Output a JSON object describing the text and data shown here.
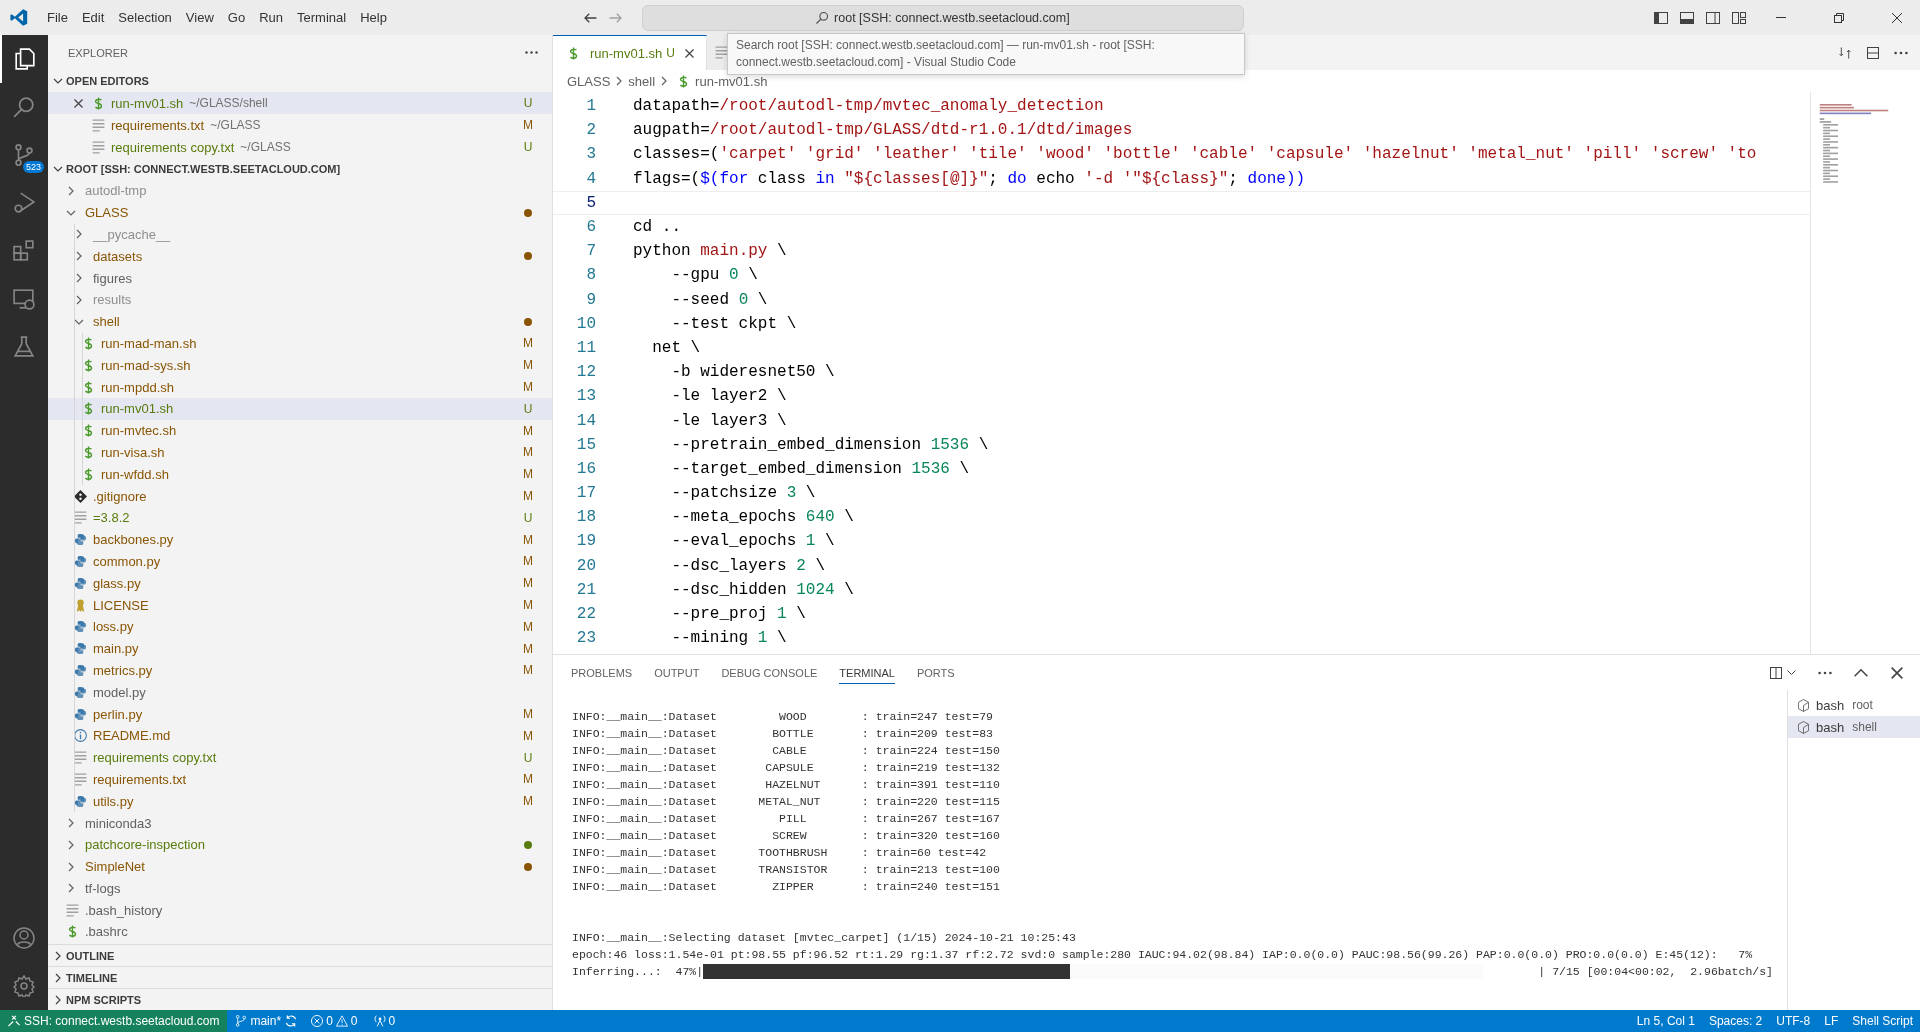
{
  "title_bar": {
    "menus": [
      "File",
      "Edit",
      "Selection",
      "View",
      "Go",
      "Run",
      "Terminal",
      "Help"
    ],
    "command_center": "root [SSH: connect.westb.seetacloud.com]"
  },
  "tooltip": "Search root [SSH: connect.westb.seetacloud.com] — run-mv01.sh - root [SSH: connect.westb.seetacloud.com] - Visual Studio Code",
  "activity_bar": {
    "items": [
      {
        "kind": "explorer",
        "selected": true
      },
      {
        "kind": "search",
        "selected": false
      },
      {
        "kind": "source-control",
        "selected": false,
        "badge": "523"
      },
      {
        "kind": "run",
        "selected": false
      },
      {
        "kind": "extensions",
        "selected": false
      },
      {
        "kind": "remote",
        "selected": false
      },
      {
        "kind": "testing",
        "selected": false
      }
    ],
    "bottom": [
      {
        "kind": "account"
      },
      {
        "kind": "settings"
      }
    ]
  },
  "sidebar": {
    "title": "EXPLORER",
    "open_editors": {
      "title": "OPEN EDITORS",
      "expanded": true,
      "items": [
        {
          "name": "run-mv01.sh",
          "description": "~/GLASS/shell",
          "kind": "shell",
          "color": "#587c0c",
          "badge": "U",
          "selected": true
        },
        {
          "name": "requirements.txt",
          "description": "~/GLASS",
          "kind": "text",
          "color": "#895503",
          "badge": "M",
          "selected": false
        },
        {
          "name": "requirements copy.txt",
          "description": "~/GLASS",
          "kind": "text",
          "color": "#587c0c",
          "badge": "U",
          "selected": false
        }
      ]
    },
    "root": {
      "title": "ROOT [SSH: CONNECT.WESTB.SEETACLOUD.COM]",
      "expanded": true,
      "tree": [
        {
          "name": "autodl-tmp",
          "kind": "folder",
          "color": "#8e8e90",
          "dot": false,
          "expanded": false,
          "selected": false
        },
        {
          "name": "GLASS",
          "kind": "folder",
          "color": "#895503",
          "dot": true,
          "expanded": true,
          "selected": false,
          "children": [
            {
              "name": "__pycache__",
              "kind": "folder",
              "color": "#8e8e90",
              "dot": false,
              "expanded": false,
              "selected": false
            },
            {
              "name": "datasets",
              "kind": "folder",
              "color": "#895503",
              "dot": true,
              "expanded": false,
              "selected": false
            },
            {
              "name": "figures",
              "kind": "folder",
              "color": "#616161",
              "dot": false,
              "expanded": false,
              "selected": false
            },
            {
              "name": "results",
              "kind": "folder",
              "color": "#8e8e90",
              "dot": false,
              "expanded": false,
              "selected": false
            },
            {
              "name": "shell",
              "kind": "folder",
              "color": "#895503",
              "dot": true,
              "expanded": true,
              "selected": false,
              "children": [
                {
                  "name": "run-mad-man.sh",
                  "kind": "shell",
                  "color": "#895503",
                  "badge": "M",
                  "selected": false
                },
                {
                  "name": "run-mad-sys.sh",
                  "kind": "shell",
                  "color": "#895503",
                  "badge": "M",
                  "selected": false
                },
                {
                  "name": "run-mpdd.sh",
                  "kind": "shell",
                  "color": "#895503",
                  "badge": "M",
                  "selected": false
                },
                {
                  "name": "run-mv01.sh",
                  "kind": "shell",
                  "color": "#587c0c",
                  "badge": "U",
                  "selected": true
                },
                {
                  "name": "run-mvtec.sh",
                  "kind": "shell",
                  "color": "#895503",
                  "badge": "M",
                  "selected": false
                },
                {
                  "name": "run-visa.sh",
                  "kind": "shell",
                  "color": "#895503",
                  "badge": "M",
                  "selected": false
                },
                {
                  "name": "run-wfdd.sh",
                  "kind": "shell",
                  "color": "#895503",
                  "badge": "M",
                  "selected": false
                }
              ]
            },
            {
              "name": ".gitignore",
              "kind": "git",
              "color": "#895503",
              "badge": "M",
              "selected": false
            },
            {
              "name": "=3.8.2",
              "kind": "text",
              "color": "#587c0c",
              "badge": "U",
              "selected": false
            },
            {
              "name": "backbones.py",
              "kind": "python",
              "color": "#895503",
              "badge": "M",
              "selected": false
            },
            {
              "name": "common.py",
              "kind": "python",
              "color": "#895503",
              "badge": "M",
              "selected": false
            },
            {
              "name": "glass.py",
              "kind": "python",
              "color": "#895503",
              "badge": "M",
              "selected": false
            },
            {
              "name": "LICENSE",
              "kind": "license",
              "color": "#895503",
              "badge": "M",
              "selected": false
            },
            {
              "name": "loss.py",
              "kind": "python",
              "color": "#895503",
              "badge": "M",
              "selected": false
            },
            {
              "name": "main.py",
              "kind": "python",
              "color": "#895503",
              "badge": "M",
              "selected": false
            },
            {
              "name": "metrics.py",
              "kind": "python",
              "color": "#895503",
              "badge": "M",
              "selected": false
            },
            {
              "name": "model.py",
              "kind": "python",
              "color": "#616161",
              "selected": false
            },
            {
              "name": "perlin.py",
              "kind": "python",
              "color": "#895503",
              "badge": "M",
              "selected": false
            },
            {
              "name": "README.md",
              "kind": "info",
              "color": "#895503",
              "badge": "M",
              "selected": false
            },
            {
              "name": "requirements copy.txt",
              "kind": "text",
              "color": "#587c0c",
              "badge": "U",
              "selected": false
            },
            {
              "name": "requirements.txt",
              "kind": "text",
              "color": "#895503",
              "badge": "M",
              "selected": false
            },
            {
              "name": "utils.py",
              "kind": "python",
              "color": "#895503",
              "badge": "M",
              "selected": false
            }
          ]
        },
        {
          "name": "miniconda3",
          "kind": "folder",
          "color": "#616161",
          "dot": false,
          "expanded": false,
          "selected": false
        },
        {
          "name": "patchcore-inspection",
          "kind": "folder",
          "color": "#587c0c",
          "dot": true,
          "expanded": false,
          "selected": false
        },
        {
          "name": "SimpleNet",
          "kind": "folder",
          "color": "#895503",
          "dot": true,
          "expanded": false,
          "selected": false
        },
        {
          "name": "tf-logs",
          "kind": "folder",
          "color": "#616161",
          "dot": false,
          "expanded": false,
          "selected": false
        },
        {
          "name": ".bash_history",
          "kind": "text",
          "color": "#616161",
          "selected": false
        },
        {
          "name": ".bashrc",
          "kind": "shell",
          "color": "#616161",
          "selected": false
        }
      ]
    },
    "sections": [
      {
        "title": "OUTLINE",
        "expanded": false
      },
      {
        "title": "TIMELINE",
        "expanded": false
      },
      {
        "title": "NPM SCRIPTS",
        "expanded": false
      }
    ]
  },
  "editor": {
    "tabs": [
      {
        "label": "run-mv01.sh",
        "badge": "U",
        "kind": "shell",
        "selected": true
      },
      {
        "kind": "text",
        "selected": false
      }
    ],
    "breadcrumbs": [
      "GLASS",
      "shell",
      "run-mv01.sh"
    ],
    "lines": [
      {
        "number": "1",
        "current": false,
        "tokens": [
          {
            "t": "datapath=",
            "kind": "text"
          },
          {
            "t": "/root/autodl-tmp/mvtec_anomaly_detection",
            "kind": "str"
          }
        ]
      },
      {
        "number": "2",
        "current": false,
        "tokens": [
          {
            "t": "augpath=",
            "kind": "text"
          },
          {
            "t": "/root/autodl-tmp/GLASS/dtd-r1.0.1/dtd/images",
            "kind": "str"
          }
        ]
      },
      {
        "number": "3",
        "current": false,
        "tokens": [
          {
            "t": "classes=(",
            "kind": "text"
          },
          {
            "t": "'carpet' 'grid' 'leather' 'tile' 'wood' 'bottle' 'cable' 'capsule' 'hazelnut' 'metal_nut' 'pill' 'screw' 'to",
            "kind": "str"
          }
        ]
      },
      {
        "number": "4",
        "current": false,
        "tokens": [
          {
            "t": "flags=(",
            "kind": "text"
          },
          {
            "t": "$(",
            "kind": "kw"
          },
          {
            "t": "for",
            "kind": "kw"
          },
          {
            "t": " class ",
            "kind": "text"
          },
          {
            "t": "in",
            "kind": "kw"
          },
          {
            "t": " \"${classes[@]}\"",
            "kind": "str"
          },
          {
            "t": "; ",
            "kind": "text"
          },
          {
            "t": "do",
            "kind": "kw"
          },
          {
            "t": " echo ",
            "kind": "text"
          },
          {
            "t": "'-d '\"${class}\"",
            "kind": "str"
          },
          {
            "t": "; ",
            "kind": "text"
          },
          {
            "t": "done",
            "kind": "kw"
          },
          {
            "t": "))",
            "kind": "kw"
          }
        ]
      },
      {
        "number": "5",
        "current": true
      },
      {
        "number": "6",
        "current": false,
        "tokens": [
          {
            "t": "cd ..",
            "kind": "text"
          }
        ]
      },
      {
        "number": "7",
        "current": false,
        "tokens": [
          {
            "t": "python ",
            "kind": "text"
          },
          {
            "t": "main.py",
            "kind": "str"
          },
          {
            "t": " \\",
            "kind": "text"
          }
        ]
      },
      {
        "number": "8",
        "current": false,
        "tokens": [
          {
            "t": "    --gpu ",
            "kind": "text"
          },
          {
            "t": "0",
            "kind": "num"
          },
          {
            "t": " \\",
            "kind": "text"
          }
        ]
      },
      {
        "number": "9",
        "current": false,
        "tokens": [
          {
            "t": "    --seed ",
            "kind": "text"
          },
          {
            "t": "0",
            "kind": "num"
          },
          {
            "t": " \\",
            "kind": "text"
          }
        ]
      },
      {
        "number": "10",
        "current": false,
        "tokens": [
          {
            "t": "    --test ckpt \\",
            "kind": "text"
          }
        ]
      },
      {
        "number": "11",
        "current": false,
        "tokens": [
          {
            "t": "  net \\",
            "kind": "text"
          }
        ]
      },
      {
        "number": "12",
        "current": false,
        "tokens": [
          {
            "t": "    -b wideresnet50 \\",
            "kind": "text"
          }
        ]
      },
      {
        "number": "13",
        "current": false,
        "tokens": [
          {
            "t": "    -le layer2 \\",
            "kind": "text"
          }
        ]
      },
      {
        "number": "14",
        "current": false,
        "tokens": [
          {
            "t": "    -le layer3 \\",
            "kind": "text"
          }
        ]
      },
      {
        "number": "15",
        "current": false,
        "tokens": [
          {
            "t": "    --pretrain_embed_dimension ",
            "kind": "text"
          },
          {
            "t": "1536",
            "kind": "num"
          },
          {
            "t": " \\",
            "kind": "text"
          }
        ]
      },
      {
        "number": "16",
        "current": false,
        "tokens": [
          {
            "t": "    --target_embed_dimension ",
            "kind": "text"
          },
          {
            "t": "1536",
            "kind": "num"
          },
          {
            "t": " \\",
            "kind": "text"
          }
        ]
      },
      {
        "number": "17",
        "current": false,
        "tokens": [
          {
            "t": "    --patchsize ",
            "kind": "text"
          },
          {
            "t": "3",
            "kind": "num"
          },
          {
            "t": " \\",
            "kind": "text"
          }
        ]
      },
      {
        "number": "18",
        "current": false,
        "tokens": [
          {
            "t": "    --meta_epochs ",
            "kind": "text"
          },
          {
            "t": "640",
            "kind": "num"
          },
          {
            "t": " \\",
            "kind": "text"
          }
        ]
      },
      {
        "number": "19",
        "current": false,
        "tokens": [
          {
            "t": "    --eval_epochs ",
            "kind": "text"
          },
          {
            "t": "1",
            "kind": "num"
          },
          {
            "t": " \\",
            "kind": "text"
          }
        ]
      },
      {
        "number": "20",
        "current": false,
        "tokens": [
          {
            "t": "    --dsc_layers ",
            "kind": "text"
          },
          {
            "t": "2",
            "kind": "num"
          },
          {
            "t": " \\",
            "kind": "text"
          }
        ]
      },
      {
        "number": "21",
        "current": false,
        "tokens": [
          {
            "t": "    --dsc_hidden ",
            "kind": "text"
          },
          {
            "t": "1024",
            "kind": "num"
          },
          {
            "t": " \\",
            "kind": "text"
          }
        ]
      },
      {
        "number": "22",
        "current": false,
        "tokens": [
          {
            "t": "    --pre_proj ",
            "kind": "text"
          },
          {
            "t": "1",
            "kind": "num"
          },
          {
            "t": " \\",
            "kind": "text"
          }
        ]
      },
      {
        "number": "23",
        "current": false,
        "tokens": [
          {
            "t": "    --mining ",
            "kind": "text"
          },
          {
            "t": "1",
            "kind": "num"
          },
          {
            "t": " \\",
            "kind": "text"
          }
        ]
      }
    ]
  },
  "panel": {
    "tabs": [
      {
        "label": "PROBLEMS",
        "selected": false
      },
      {
        "label": "OUTPUT",
        "selected": false
      },
      {
        "label": "DEBUG CONSOLE",
        "selected": false
      },
      {
        "label": "TERMINAL",
        "selected": true
      },
      {
        "label": "PORTS",
        "selected": false
      }
    ],
    "output": [
      "INFO:__main__:Dataset         WOOD        : train=247 test=79",
      "INFO:__main__:Dataset        BOTTLE       : train=209 test=83",
      "INFO:__main__:Dataset        CABLE        : train=224 test=150",
      "INFO:__main__:Dataset       CAPSULE       : train=219 test=132",
      "INFO:__main__:Dataset       HAZELNUT      : train=391 test=110",
      "INFO:__main__:Dataset      METAL_NUT      : train=220 test=115",
      "INFO:__main__:Dataset         PILL        : train=267 test=167",
      "INFO:__main__:Dataset        SCREW        : train=320 test=160",
      "INFO:__main__:Dataset      TOOTHBRUSH     : train=60 test=42",
      "INFO:__main__:Dataset      TRANSISTOR     : train=213 test=100",
      "INFO:__main__:Dataset        ZIPPER       : train=240 test=151"
    ],
    "status_lines": [
      "INFO:__main__:Selecting dataset [mvtec_carpet] (1/15) 2024-10-21 10:25:43",
      "epoch:46 loss:1.54e-01 pt:98.55 pf:96.52 rt:1.29 rg:1.37 rf:2.72 svd:0 sample:280 IAUC:94.02(98.84) IAP:0.0(0.0) PAUC:98.56(99.26) PAP:0.0(0.0) PRO:0.0(0.0) E:45(12):   7%"
    ],
    "progress": {
      "label": "Inferring...:  47%|",
      "level": 0.47,
      "suffix": "| 7/15 [00:04<00:02,  2.96batch/s]"
    },
    "sessions": [
      {
        "shell": "bash",
        "name": "root",
        "selected": false
      },
      {
        "shell": "bash",
        "name": "shell",
        "selected": true
      }
    ]
  },
  "status_bar": {
    "remote": "SSH: connect.westb.seetacloud.com",
    "branch": "main*",
    "errors": "0",
    "warnings": "0",
    "ports": "0",
    "right": [
      "Ln 5, Col 1",
      "Spaces: 2",
      "UTF-8",
      "LF",
      "Shell Script"
    ]
  }
}
